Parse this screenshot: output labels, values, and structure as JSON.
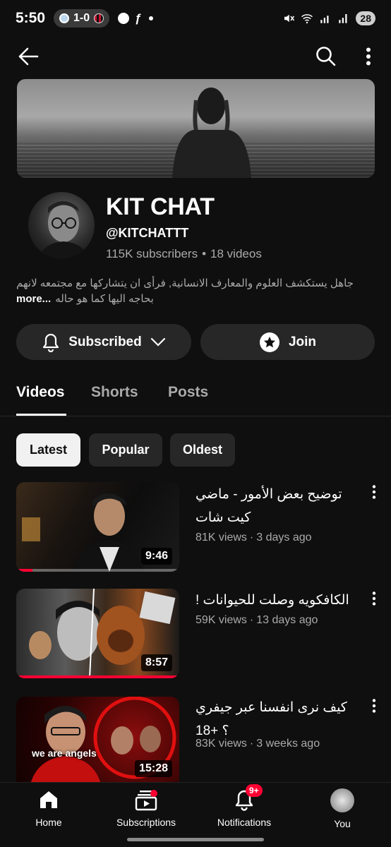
{
  "status_bar": {
    "time": "5:50",
    "score": "1-0",
    "battery": "28"
  },
  "channel": {
    "name": "KIT CHAT",
    "handle": "@KITCHATTT",
    "subscribers": "115K subscribers",
    "separator": "•",
    "videos_count": "18 videos",
    "description_line1": "جاهل يستكشف العلوم والمعارف الانسانية, فرأى ان يتشاركها مع مجتمعه لانهم",
    "description_more": "more...",
    "description_line2": "بحاجه اليها كما هو حاله"
  },
  "actions": {
    "subscribed_label": "Subscribed",
    "join_label": "Join"
  },
  "tabs": [
    {
      "label": "Videos",
      "active": true
    },
    {
      "label": "Shorts",
      "active": false
    },
    {
      "label": "Posts",
      "active": false
    }
  ],
  "chips": [
    {
      "label": "Latest",
      "active": true
    },
    {
      "label": "Popular",
      "active": false
    },
    {
      "label": "Oldest",
      "active": false
    }
  ],
  "videos": [
    {
      "title": "توضيح بعض الأمور - ماضي كيت شات",
      "views": "81K views",
      "separator": "·",
      "age": "3 days ago",
      "duration": "9:46",
      "watched_fraction": 0.1
    },
    {
      "title": "الكافكويه وصلت للحيوانات !",
      "views": "59K views",
      "separator": "·",
      "age": "13 days ago",
      "duration": "8:57",
      "watched_fraction": 1.0
    },
    {
      "title": "كيف نرى انفسنا عبر جيفري ؟ +18",
      "views": "83K views",
      "separator": "·",
      "age": "3 weeks ago",
      "duration": "15:28",
      "thumb_text": "we are angels"
    }
  ],
  "bottom_nav": {
    "home": "Home",
    "subscriptions": "Subscriptions",
    "notifications": "Notifications",
    "notifications_badge": "9+",
    "you": "You"
  },
  "colors": {
    "background": "#0f0f0f",
    "accent_red": "#ff0033",
    "pill_bg": "#272727",
    "secondary_text": "#aaaaaa"
  }
}
